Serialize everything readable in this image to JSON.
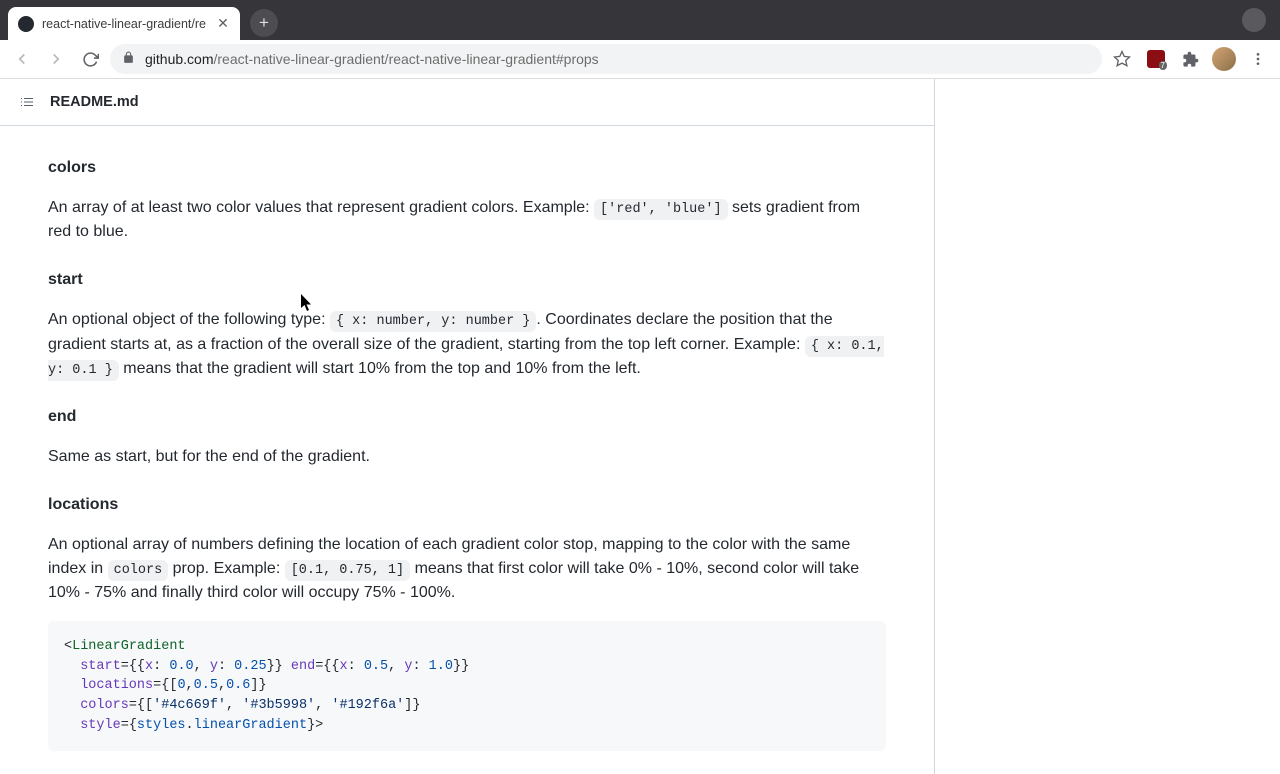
{
  "browser": {
    "tab_title": "react-native-linear-gradient/re",
    "url_host": "github.com",
    "url_path": "/react-native-linear-gradient/react-native-linear-gradient#props"
  },
  "readme": {
    "filename": "README.md",
    "sections": {
      "colors": {
        "heading": "colors",
        "text_before": "An array of at least two color values that represent gradient colors. Example: ",
        "code": "['red', 'blue']",
        "text_after": " sets gradient from red to blue."
      },
      "start": {
        "heading": "start",
        "p1_before": "An optional object of the following type: ",
        "p1_code1": "{ x: number, y: number }",
        "p1_mid": ". Coordinates declare the position that the gradient starts at, as a fraction of the overall size of the gradient, starting from the top left corner. Example: ",
        "p1_code2": "{ x: 0.1, y: 0.1 }",
        "p1_after": " means that the gradient will start 10% from the top and 10% from the left."
      },
      "end": {
        "heading": "end",
        "text": "Same as start, but for the end of the gradient."
      },
      "locations": {
        "heading": "locations",
        "p_before": "An optional array of numbers defining the location of each gradient color stop, mapping to the color with the same index in ",
        "p_code1": "colors",
        "p_mid": " prop. Example: ",
        "p_code2": "[0.1, 0.75, 1]",
        "p_after": " means that first color will take 0% - 10%, second color will take 10% - 75% and finally third color will occupy 75% - 100%."
      }
    },
    "code_example": {
      "tag": "LinearGradient",
      "attrs": {
        "start": "{{x: 0.0, y: 0.25}}",
        "end": "{{x: 0.5, y: 1.0}}",
        "locations": "{[0,0.5,0.6]}",
        "colors": "{['#4c669f', '#3b5998', '#192f6a']}",
        "style": "{styles.linearGradient}"
      }
    }
  }
}
